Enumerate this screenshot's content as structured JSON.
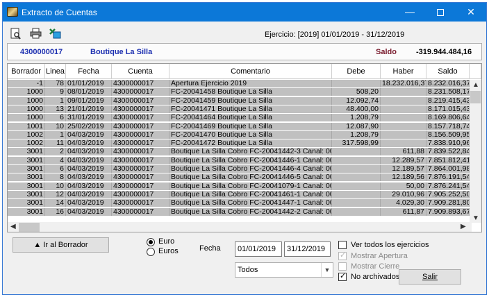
{
  "window": {
    "title": "Extracto de Cuentas",
    "min": "—",
    "close": "✕"
  },
  "toolbar": {
    "ejercicio": "Ejercicio: [2019] 01/01/2019 - 31/12/2019",
    "icons": [
      "preview-icon",
      "print-icon",
      "excel-export-icon"
    ]
  },
  "account": {
    "code": "4300000017",
    "name": "Boutique La Silla",
    "saldo_label": "Saldo",
    "saldo_value": "-319.944.484,16"
  },
  "table": {
    "headers": [
      "Borrador",
      "Linea",
      "Fecha",
      "Cuenta",
      "Comentario",
      "Debe",
      "Haber",
      "Saldo"
    ],
    "rows": [
      [
        "-1",
        "78",
        "01/01/2019",
        "4300000017",
        "Apertura Ejercicio 2019",
        "",
        "18.232.016,37",
        "8.232.016,37"
      ],
      [
        "1000",
        "9",
        "08/01/2019",
        "4300000017",
        "FC-20041458 Boutique La Silla",
        "508,20",
        "",
        "8.231.508,17"
      ],
      [
        "1000",
        "1",
        "09/01/2019",
        "4300000017",
        "FC-20041459 Boutique La Silla",
        "12.092,74",
        "",
        "8.219.415,43"
      ],
      [
        "1000",
        "13",
        "21/01/2019",
        "4300000017",
        "FC-20041471 Boutique La Silla",
        "48.400,00",
        "",
        "8.171.015,43"
      ],
      [
        "1000",
        "6",
        "31/01/2019",
        "4300000017",
        "FC-20041464 Boutique La Silla",
        "1.208,79",
        "",
        "8.169.806,64"
      ],
      [
        "1001",
        "10",
        "25/02/2019",
        "4300000017",
        "FC-20041469 Boutique La Silla",
        "12.087,90",
        "",
        "8.157.718,74"
      ],
      [
        "1002",
        "1",
        "04/03/2019",
        "4300000017",
        "FC-20041470 Boutique La Silla",
        "1.208,79",
        "",
        "8.156.509,95"
      ],
      [
        "1002",
        "11",
        "04/03/2019",
        "4300000017",
        "FC-20041472 Boutique La Silla",
        "317.598,99",
        "",
        "7.838.910,96"
      ],
      [
        "3001",
        "2",
        "04/03/2019",
        "4300000017",
        "Boutique La Silla Cobro FC-20041442-3 Canal: 0004",
        "",
        "611,88",
        "7.839.522,84"
      ],
      [
        "3001",
        "4",
        "04/03/2019",
        "4300000017",
        "Boutique La Silla Cobro FC-20041446-1 Canal: 0004",
        "",
        "12.289,57",
        "7.851.812,41"
      ],
      [
        "3001",
        "6",
        "04/03/2019",
        "4300000017",
        "Boutique La Silla Cobro FC-20041446-4 Canal: 0004",
        "",
        "12.189,57",
        "7.864.001,98"
      ],
      [
        "3001",
        "8",
        "04/03/2019",
        "4300000017",
        "Boutique La Silla Cobro FC-20041446-5 Canal: 0004",
        "",
        "12.189,56",
        "7.876.191,54"
      ],
      [
        "3001",
        "10",
        "04/03/2019",
        "4300000017",
        "Boutique La Silla Cobro FC-20041079-1 Canal: 0004",
        "",
        "50,00",
        "7.876.241,54"
      ],
      [
        "3001",
        "12",
        "04/03/2019",
        "4300000017",
        "Boutique La Silla Cobro FC-20041461-1 Canal: 0004",
        "",
        "29.010,96",
        "7.905.252,50"
      ],
      [
        "3001",
        "14",
        "04/03/2019",
        "4300000017",
        "Boutique La Silla Cobro FC-20041447-1 Canal: 0004",
        "",
        "4.029,30",
        "7.909.281,80"
      ],
      [
        "3001",
        "16",
        "04/03/2019",
        "4300000017",
        "Boutique La Silla Cobro FC-20041442-2 Canal: 0004",
        "",
        "611,87",
        "7.909.893,67"
      ]
    ]
  },
  "bottom": {
    "borrador_button": "▲ Ir al Borrador",
    "radio_euro": "Euro",
    "radio_euros": "Euros",
    "fecha_label": "Fecha",
    "fecha_desde": "01/01/2019",
    "fecha_hasta": "31/12/2019",
    "filtro_select": "Todos",
    "ver_todos": "Ver todos los ejercicios",
    "mostrar_apertura": "Mostrar Apertura",
    "mostrar_cierre": "Mostrar Cierre",
    "no_archivados": "No archivados",
    "salir": "Salir"
  }
}
